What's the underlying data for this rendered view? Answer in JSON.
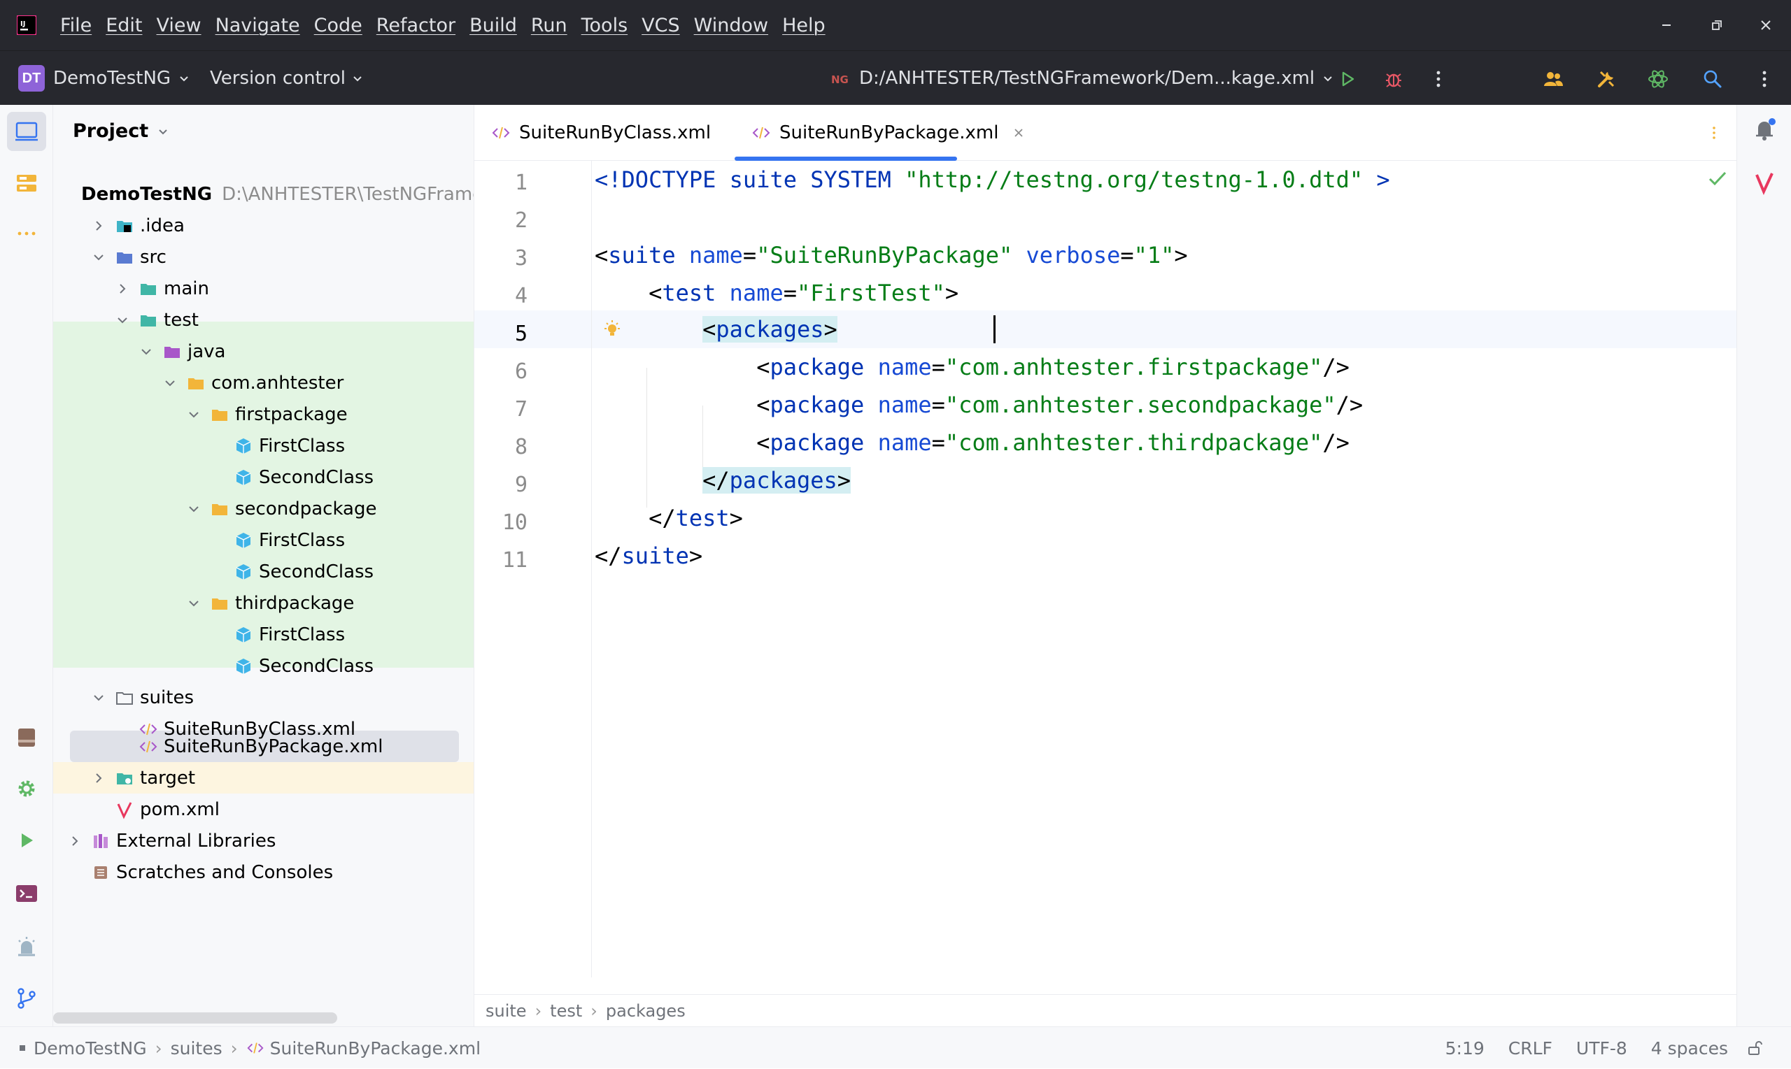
{
  "menu": [
    "File",
    "Edit",
    "View",
    "Navigate",
    "Code",
    "Refactor",
    "Build",
    "Run",
    "Tools",
    "VCS",
    "Window",
    "Help"
  ],
  "toolbar": {
    "project_badge": "DT",
    "project_name": "DemoTestNG",
    "version_control": "Version control",
    "run_config": "D:/ANHTESTER/TestNGFramework/Dem...kage.xml"
  },
  "project_panel": {
    "title": "Project",
    "tree": [
      {
        "label": "DemoTestNG",
        "hint": "D:\\ANHTESTER\\TestNGFramework",
        "bold": true
      },
      {
        "label": ".idea"
      },
      {
        "label": "src"
      },
      {
        "label": "main"
      },
      {
        "label": "test"
      },
      {
        "label": "java"
      },
      {
        "label": "com.anhtester"
      },
      {
        "label": "firstpackage"
      },
      {
        "label": "FirstClass"
      },
      {
        "label": "SecondClass"
      },
      {
        "label": "secondpackage"
      },
      {
        "label": "FirstClass"
      },
      {
        "label": "SecondClass"
      },
      {
        "label": "thirdpackage"
      },
      {
        "label": "FirstClass"
      },
      {
        "label": "SecondClass"
      },
      {
        "label": "suites"
      },
      {
        "label": "SuiteRunByClass.xml"
      },
      {
        "label": "SuiteRunByPackage.xml"
      },
      {
        "label": "target"
      },
      {
        "label": "pom.xml"
      },
      {
        "label": "External Libraries"
      },
      {
        "label": "Scratches and Consoles"
      }
    ]
  },
  "editor": {
    "tabs": [
      {
        "label": "SuiteRunByClass.xml"
      },
      {
        "label": "SuiteRunByPackage.xml"
      }
    ],
    "line_numbers": [
      "1",
      "2",
      "3",
      "4",
      "5",
      "6",
      "7",
      "8",
      "9",
      "10",
      "11"
    ],
    "lines": {
      "l1": {
        "a": "<!DOCTYPE suite SYSTEM ",
        "b": "\"http://testng.org/testng-1.0.dtd\"",
        "c": " >"
      },
      "l3": {
        "a": "<",
        "tag": "suite",
        "sp": " ",
        "attr1": "name",
        "eq1": "=",
        "val1": "\"SuiteRunByPackage\"",
        "sp2": " ",
        "attr2": "verbose",
        "eq2": "=",
        "val2": "\"1\"",
        "end": ">"
      },
      "l4": {
        "indent": "    ",
        "a": "<",
        "tag": "test",
        "sp": " ",
        "attr": "name",
        "eq": "=",
        "val": "\"FirstTest\"",
        "end": ">"
      },
      "l5": {
        "indent": "        ",
        "open": "<",
        "tag": "packages",
        "close": ">"
      },
      "l6": {
        "indent": "            ",
        "a": "<",
        "tag": "package",
        "sp": " ",
        "attr": "name",
        "eq": "=",
        "val": "\"com.anhtester.firstpackage\"",
        "end": "/>"
      },
      "l7": {
        "indent": "            ",
        "a": "<",
        "tag": "package",
        "sp": " ",
        "attr": "name",
        "eq": "=",
        "val": "\"com.anhtester.secondpackage\"",
        "end": "/>"
      },
      "l8": {
        "indent": "            ",
        "a": "<",
        "tag": "package",
        "sp": " ",
        "attr": "name",
        "eq": "=",
        "val": "\"com.anhtester.thirdpackage\"",
        "end": "/>"
      },
      "l9": {
        "indent": "        ",
        "open": "</",
        "tag": "packages",
        "close": ">"
      },
      "l10": {
        "indent": "    ",
        "open": "</",
        "tag": "test",
        "close": ">"
      },
      "l11": {
        "open": "</",
        "tag": "suite",
        "close": ">"
      }
    },
    "breadcrumbs": [
      "suite",
      "test",
      "packages"
    ]
  },
  "statusbar": {
    "path": [
      "DemoTestNG",
      "suites",
      "SuiteRunByPackage.xml"
    ],
    "position": "5:19",
    "line_sep": "CRLF",
    "encoding": "UTF-8",
    "indent": "4 spaces"
  },
  "colors": {
    "accent": "#3574f0",
    "tag": "#0033b3",
    "attribute": "#174ad4",
    "string": "#067d17",
    "test_source_bg": "#e3f5e3",
    "excluded_bg": "#fdf5e0"
  }
}
